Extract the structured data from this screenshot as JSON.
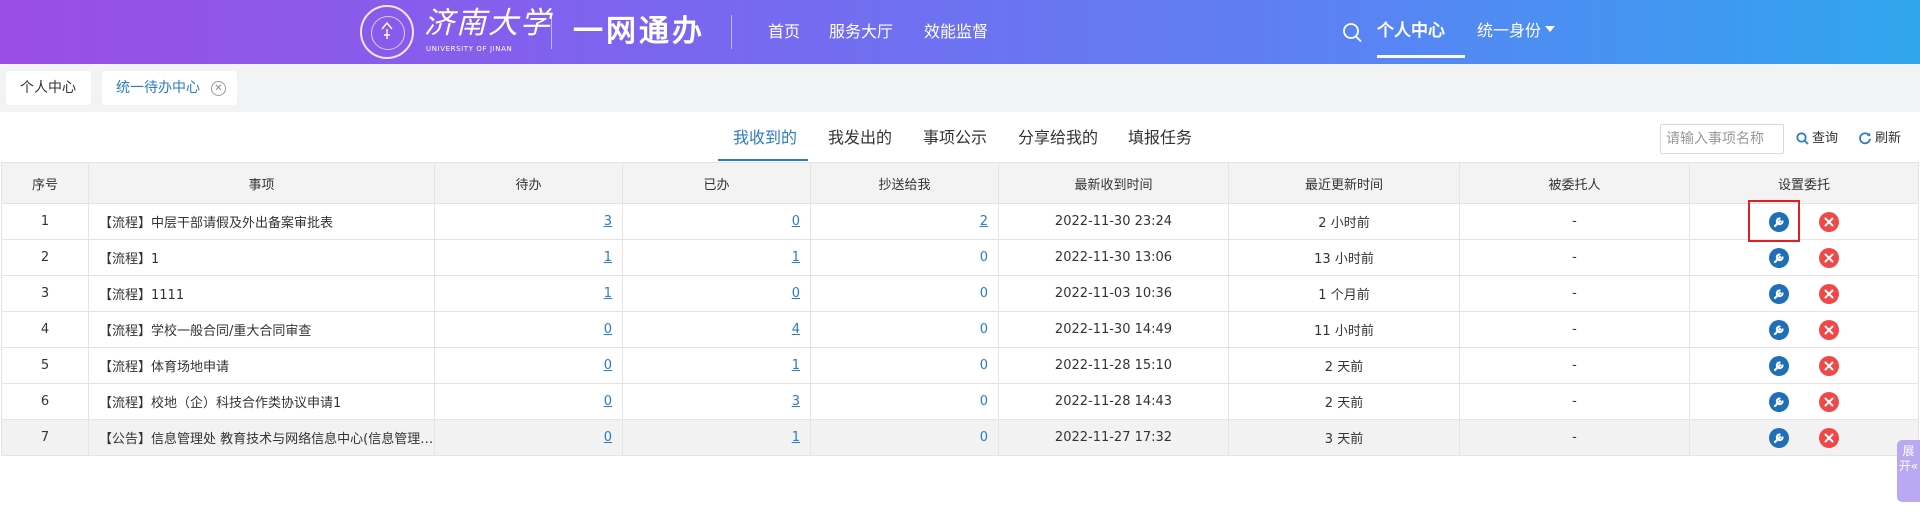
{
  "header": {
    "university_name": "济南大学",
    "university_en": "UNIVERSITY OF JINAN",
    "system_title": "一网通办",
    "nav": [
      "首页",
      "服务大厅",
      "效能监督"
    ],
    "personal_center": "个人中心",
    "identity": "统一身份"
  },
  "page_tabs": [
    {
      "label": "个人中心"
    },
    {
      "label": "统一待办中心"
    }
  ],
  "sub_tabs": [
    "我收到的",
    "我发出的",
    "事项公示",
    "分享给我的",
    "填报任务"
  ],
  "active_sub_tab": "我收到的",
  "toolbar": {
    "search_placeholder": "请输入事项名称",
    "query_label": "查询",
    "refresh_label": "刷新"
  },
  "table": {
    "columns": [
      "序号",
      "事项",
      "待办",
      "已办",
      "抄送给我",
      "最新收到时间",
      "最近更新时间",
      "被委托人",
      "设置委托"
    ],
    "rows": [
      {
        "no": "1",
        "item": "【流程】中层干部请假及外出备案审批表",
        "todo": "3",
        "done": "0",
        "cc": "2",
        "received": "2022-11-30 23:24",
        "updated": "2 小时前",
        "delegate": "-"
      },
      {
        "no": "2",
        "item": "【流程】1",
        "todo": "1",
        "done": "1",
        "cc": "0",
        "received": "2022-11-30 13:06",
        "updated": "13 小时前",
        "delegate": "-"
      },
      {
        "no": "3",
        "item": "【流程】1111",
        "todo": "1",
        "done": "0",
        "cc": "0",
        "received": "2022-11-03 10:36",
        "updated": "1 个月前",
        "delegate": "-"
      },
      {
        "no": "4",
        "item": "【流程】学校一般合同/重大合同审查",
        "todo": "0",
        "done": "4",
        "cc": "0",
        "received": "2022-11-30 14:49",
        "updated": "11 小时前",
        "delegate": "-"
      },
      {
        "no": "5",
        "item": "【流程】体育场地申请",
        "todo": "0",
        "done": "1",
        "cc": "0",
        "received": "2022-11-28 15:10",
        "updated": "2 天前",
        "delegate": "-"
      },
      {
        "no": "6",
        "item": "【流程】校地（企）科技合作类协议申请1",
        "todo": "0",
        "done": "3",
        "cc": "0",
        "received": "2022-11-28 14:43",
        "updated": "2 天前",
        "delegate": "-"
      },
      {
        "no": "7",
        "item": "【公告】信息管理处 教育技术与网络信息中心(信息管理处 ...",
        "todo": "0",
        "done": "1",
        "cc": "0",
        "received": "2022-11-27 17:32",
        "updated": "3 天前",
        "delegate": "-"
      }
    ]
  },
  "side_pull": "展开«",
  "icons": {
    "search": "search-icon",
    "set_delegate": "wrench-icon",
    "delete": "close-icon",
    "refresh": "refresh-icon"
  },
  "colors": {
    "header_start": "#9b4de6",
    "header_end": "#2fa6ee",
    "accent": "#2c7bc5",
    "delete": "#f04848",
    "highlight": "#e02020"
  }
}
